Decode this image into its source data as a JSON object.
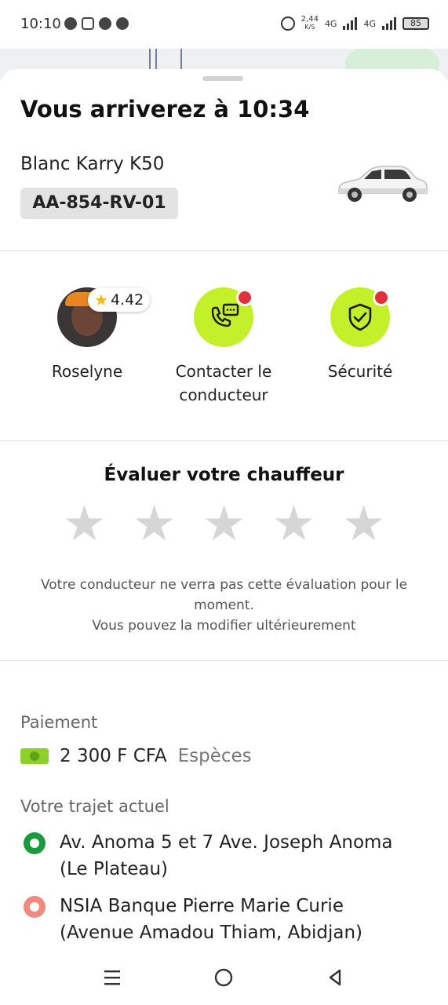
{
  "status_bar": {
    "time": "10:10",
    "net_speed": "2,44",
    "net_unit": "K/S",
    "net1": "4G",
    "net2": "4G",
    "battery": "85"
  },
  "trip_header": {
    "arrival": "Vous arriverez à 10:34",
    "car_name": "Blanc Karry K50",
    "plate": "AA-854-RV-01"
  },
  "driver": {
    "name": "Roselyne",
    "rating": "4.42"
  },
  "actions": {
    "contact_label": "Contacter le conducteur",
    "safety_label": "Sécurité"
  },
  "rating_section": {
    "title": "Évaluer votre chauffeur",
    "stars": [
      "★",
      "★",
      "★",
      "★",
      "★"
    ],
    "note_line1": "Votre conducteur ne verra pas cette évaluation pour le moment.",
    "note_line2": "Vous pouvez la modifier ultérieurement"
  },
  "payment": {
    "label": "Paiement",
    "amount": "2 300 F CFA",
    "method": "Espèces"
  },
  "route": {
    "label": "Votre trajet actuel",
    "pickup": "Av. Anoma 5 et 7 Ave. Joseph Anoma (Le Plateau)",
    "dropoff": "NSIA Banque Pierre Marie Curie (Avenue Amadou Thiam, Abidjan)"
  },
  "colors": {
    "accent": "#c4f02a",
    "notification_dot": "#e0303a",
    "pickup_pin": "#1c9a3e",
    "dropoff_pin": "#f08a80"
  }
}
